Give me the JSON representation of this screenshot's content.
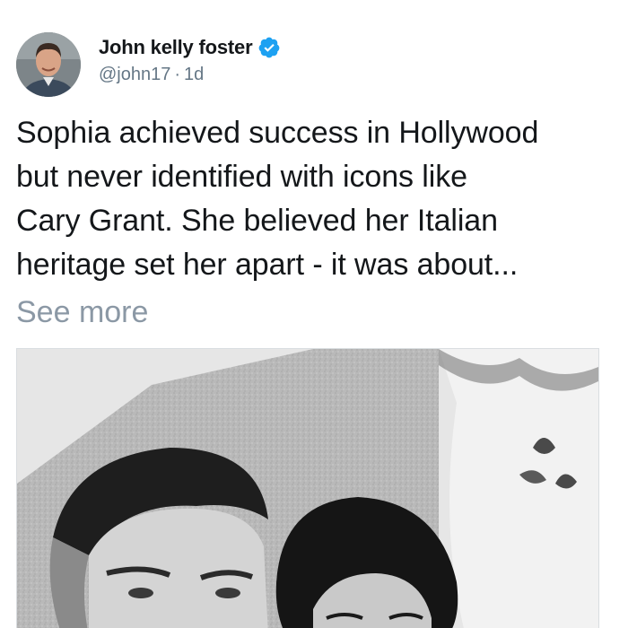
{
  "post": {
    "author": {
      "name": "John kelly foster",
      "handle": "@john17",
      "separator": "·",
      "time": "1d",
      "verified": true,
      "avatar_icon": "avatar-photo"
    },
    "text_lines": [
      "Sophia achieved success in Hollywood",
      "but never identified with icons like",
      "Cary Grant. She believed her Italian",
      "heritage set her apart - it was about..."
    ],
    "see_more": "See more",
    "media": {
      "type": "photo",
      "description_icon": "black-and-white-photo"
    }
  },
  "colors": {
    "text": "#14171a",
    "secondary": "#657786",
    "see_more": "#8b98a5",
    "verified": "#1da1f2"
  }
}
